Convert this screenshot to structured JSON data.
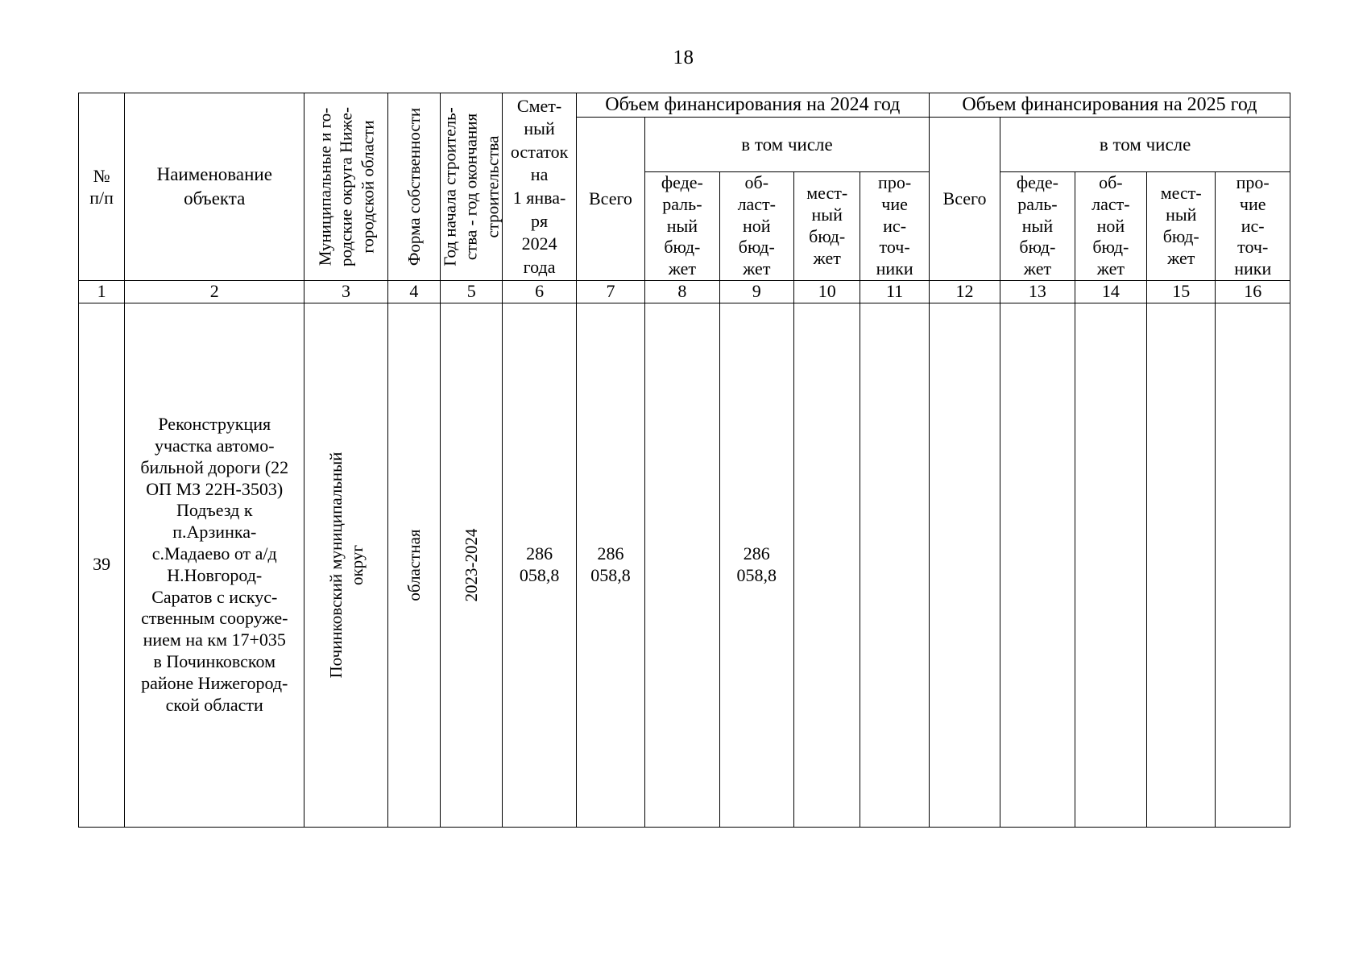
{
  "document": {
    "page_number": "18"
  },
  "table": {
    "headers": {
      "col1": "№\nп/п",
      "col1_line1": "№",
      "col1_line2": "п/п",
      "col2": "Наименование\nобъекта",
      "col2_line1": "Наименование",
      "col2_line2": "объекта",
      "col3": "Муниципальные  и го-родские округа Ниже-городской области",
      "col3_display": "Муниципальные  и го-родские округа Ниже-городской области",
      "col4": "Форма собственности",
      "col5": "Год начала строитель-ства - год окончания строительства",
      "col6_lines": [
        "Смет-",
        "ный",
        "остаток",
        "на",
        "1 янва-",
        "ря",
        "2024",
        "года"
      ],
      "group_2024": "Объем финансирования на 2024 год",
      "group_2025": "Объем финансирования на 2025 год",
      "in_which": "в том числе",
      "total": "Всего",
      "federal_lines": [
        "феде-",
        "раль-",
        "ный",
        "бюд-",
        "жет"
      ],
      "regional_lines": [
        "об-",
        "ласт-",
        "ной",
        "бюд-",
        "жет"
      ],
      "local_lines": [
        "мест-",
        "ный",
        "бюд-",
        "жет"
      ],
      "other_lines": [
        "про-",
        "чие",
        "ис-",
        "точ-",
        "ники"
      ]
    },
    "column_numbers": [
      "1",
      "2",
      "3",
      "4",
      "5",
      "6",
      "7",
      "8",
      "9",
      "10",
      "11",
      "12",
      "13",
      "14",
      "15",
      "16"
    ],
    "rows": [
      {
        "num": "39",
        "object_name": "Реконструкция участка автомо-бильной дороги (22 ОП МЗ 22Н-3503) Подъезд к п.Арзинка-с.Мадаево от а/д Н.Новгород-Саратов с искус-ственным сооруже-нием   на км 17+035 в Починковском районе Нижегород-ской области",
        "object_name_lines": [
          "Реконструкция",
          "участка автомо-",
          "бильной дороги (22",
          "ОП МЗ 22Н-3503)",
          "Подъезд к",
          "п.Арзинка-",
          "с.Мадаево от а/д",
          "Н.Новгород-",
          "Саратов с искус-",
          "ственным сооруже-",
          "нием   на км 17+035",
          "в Починковском",
          "районе Нижегород-",
          "ской области"
        ],
        "municipality": "Починковский муниципальный округ",
        "ownership": "областная",
        "years": "2023-2024",
        "estimate_balance": "286 058,8",
        "estimate_balance_l1": "286",
        "estimate_balance_l2": "058,8",
        "y2024_total": "286 058,8",
        "y2024_total_l1": "286",
        "y2024_total_l2": "058,8",
        "y2024_federal": "",
        "y2024_regional": "286 058,8",
        "y2024_regional_l1": "286",
        "y2024_regional_l2": "058,8",
        "y2024_local": "",
        "y2024_other": "",
        "y2025_total": "",
        "y2025_federal": "",
        "y2025_regional": "",
        "y2025_local": "",
        "y2025_other": ""
      }
    ]
  }
}
